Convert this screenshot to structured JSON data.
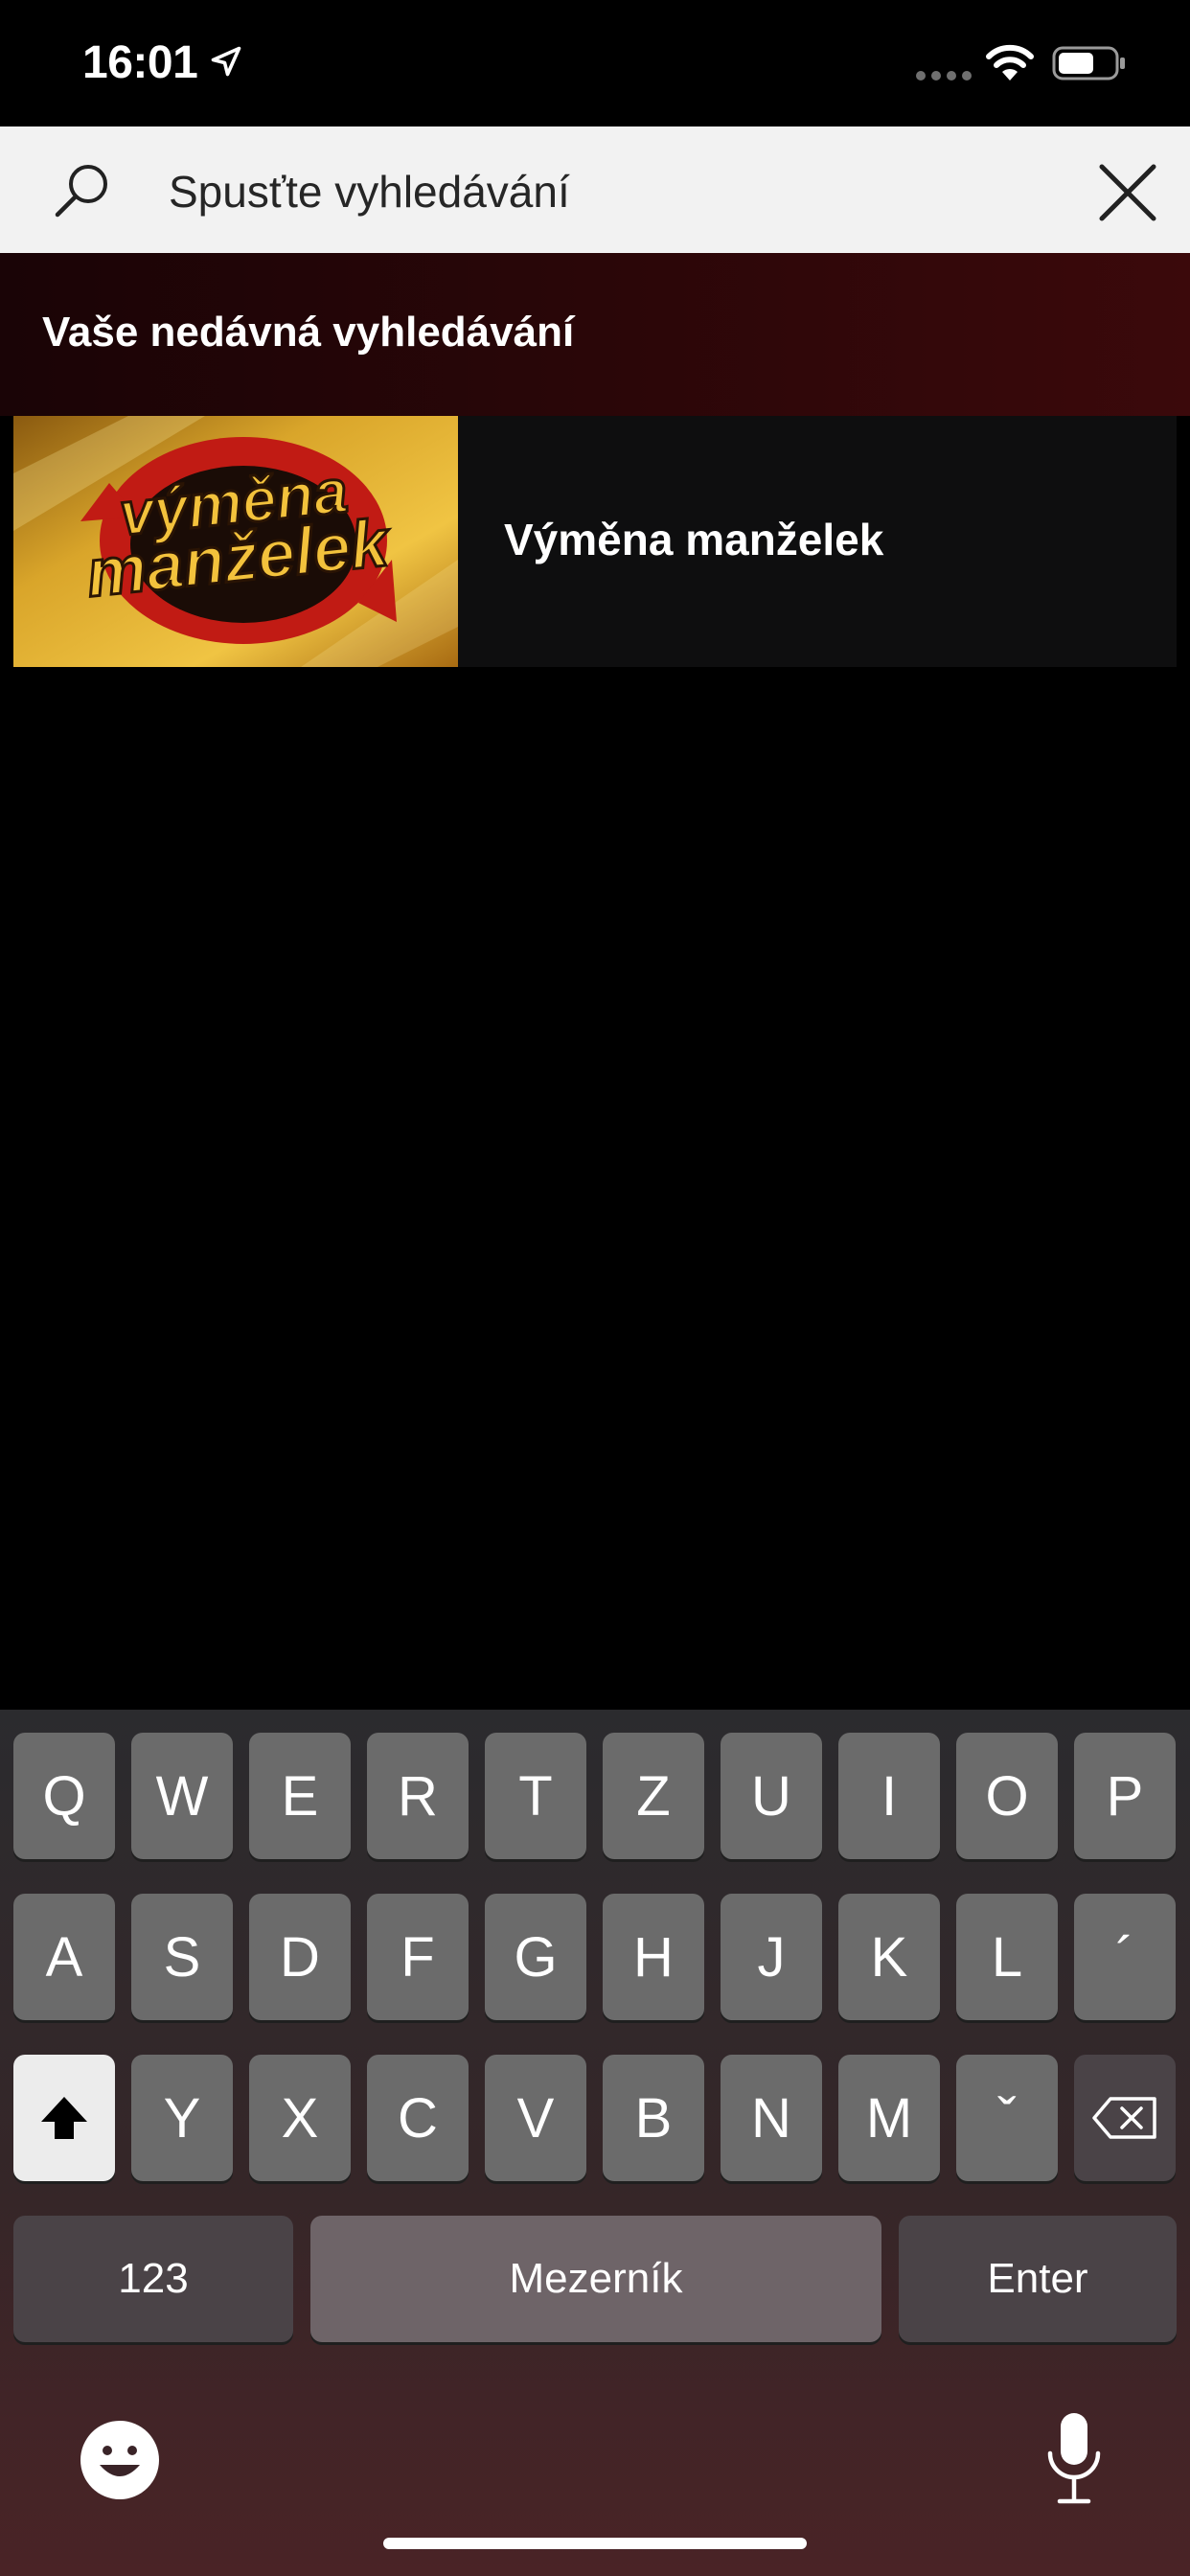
{
  "status_bar": {
    "time": "16:01"
  },
  "search": {
    "placeholder": "Spusťte vyhledávání"
  },
  "recent": {
    "title": "Vaše nedávná vyhledávání",
    "items": [
      {
        "label": "Výměna manželek",
        "thumb_line1": "výměna",
        "thumb_line2": "manželek"
      }
    ]
  },
  "keyboard": {
    "row1": [
      "Q",
      "W",
      "E",
      "R",
      "T",
      "Z",
      "U",
      "I",
      "O",
      "P"
    ],
    "row2": [
      "A",
      "S",
      "D",
      "F",
      "G",
      "H",
      "J",
      "K",
      "L",
      "´"
    ],
    "row3": [
      "Y",
      "X",
      "C",
      "V",
      "B",
      "N",
      "M",
      "ˇ"
    ],
    "numbers_label": "123",
    "space_label": "Mezerník",
    "enter_label": "Enter"
  },
  "colors": {
    "accent": "#e60000",
    "search_bar": "#f2f2f2",
    "key": "#6b6b6b"
  }
}
